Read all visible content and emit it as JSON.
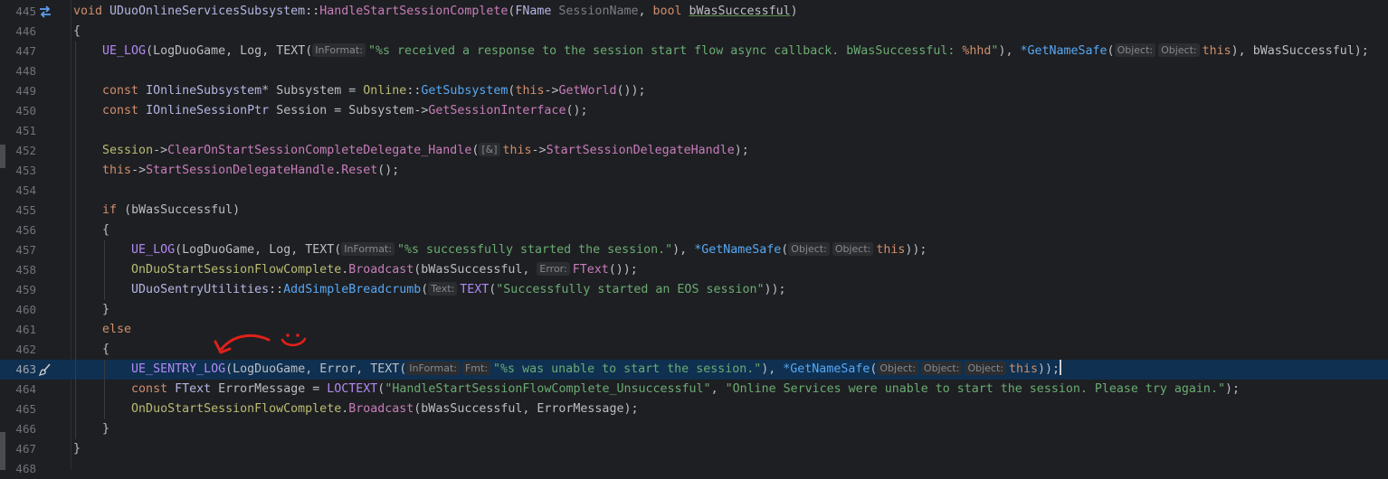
{
  "editor": {
    "lines": [
      {
        "n": "445",
        "segs": [
          [
            "kw",
            "void "
          ],
          [
            "ty",
            "UDuoOnlineServicesSubsystem"
          ],
          [
            "par",
            "::"
          ],
          [
            "fnp",
            "HandleStartSessionComplete"
          ],
          [
            "par",
            "("
          ],
          [
            "ty",
            "FName "
          ],
          [
            "grey",
            "SessionName"
          ],
          [
            "par",
            ", "
          ],
          [
            "kw",
            "bool "
          ],
          [
            "par underline",
            "bWasSuccessful"
          ],
          [
            "par",
            ")"
          ]
        ]
      },
      {
        "n": "446",
        "segs": [
          [
            "par",
            "{"
          ]
        ]
      },
      {
        "n": "447",
        "segs": [
          [
            "par",
            "    "
          ],
          [
            "mac2",
            "UE_LOG"
          ],
          [
            "par",
            "("
          ],
          [
            "par",
            "LogDuoGame"
          ],
          [
            "par",
            ", "
          ],
          [
            "par",
            "Log"
          ],
          [
            "par",
            ", "
          ],
          [
            "par",
            "TEXT("
          ],
          [
            "hint",
            "InFormat:"
          ],
          [
            "str",
            "\"%s received a response to the session start flow async callback. bWasSuccessful: "
          ],
          [
            "esc",
            "%hhd"
          ],
          [
            "str",
            "\""
          ],
          [
            "par",
            "), "
          ],
          [
            "fn",
            "*GetNameSafe"
          ],
          [
            "par",
            "("
          ],
          [
            "hint",
            "Object:"
          ],
          [
            "hint",
            "Object:"
          ],
          [
            "this",
            "this"
          ],
          [
            "par",
            "), "
          ],
          [
            "par",
            "bWasSuccessful"
          ],
          [
            "par",
            ");"
          ]
        ]
      },
      {
        "n": "448",
        "segs": []
      },
      {
        "n": "449",
        "segs": [
          [
            "par",
            "    "
          ],
          [
            "kw",
            "const "
          ],
          [
            "ty",
            "IOnlineSubsystem"
          ],
          [
            "par",
            "* "
          ],
          [
            "par",
            "Subsystem"
          ],
          [
            "par",
            " = "
          ],
          [
            "tya",
            "Online"
          ],
          [
            "par",
            "::"
          ],
          [
            "fn",
            "GetSubsystem"
          ],
          [
            "par",
            "("
          ],
          [
            "this",
            "this"
          ],
          [
            "par",
            "->"
          ],
          [
            "fnp",
            "GetWorld"
          ],
          [
            "par",
            "());"
          ]
        ]
      },
      {
        "n": "450",
        "segs": [
          [
            "par",
            "    "
          ],
          [
            "kw",
            "const "
          ],
          [
            "ty",
            "IOnlineSessionPtr "
          ],
          [
            "par",
            "Session"
          ],
          [
            "par",
            " = "
          ],
          [
            "par",
            "Subsystem"
          ],
          [
            "par",
            "->"
          ],
          [
            "fnp",
            "GetSessionInterface"
          ],
          [
            "par",
            "();"
          ]
        ]
      },
      {
        "n": "451",
        "segs": []
      },
      {
        "n": "452",
        "segs": [
          [
            "par",
            "    "
          ],
          [
            "tya",
            "Session"
          ],
          [
            "par",
            "->"
          ],
          [
            "fnp",
            "ClearOnStartSessionCompleteDelegate_Handle"
          ],
          [
            "par",
            "("
          ],
          [
            "hint",
            "[&]"
          ],
          [
            "this",
            "this"
          ],
          [
            "par",
            "->"
          ],
          [
            "fnp",
            "StartSessionDelegateHandle"
          ],
          [
            "par",
            ");"
          ]
        ]
      },
      {
        "n": "453",
        "segs": [
          [
            "par",
            "    "
          ],
          [
            "this",
            "this"
          ],
          [
            "par",
            "->"
          ],
          [
            "fnp",
            "StartSessionDelegateHandle"
          ],
          [
            "par",
            "."
          ],
          [
            "fnp",
            "Reset"
          ],
          [
            "par",
            "();"
          ]
        ]
      },
      {
        "n": "454",
        "segs": []
      },
      {
        "n": "455",
        "segs": [
          [
            "par",
            "    "
          ],
          [
            "kw",
            "if "
          ],
          [
            "par",
            "(bWasSuccessful)"
          ]
        ]
      },
      {
        "n": "456",
        "segs": [
          [
            "par",
            "    {"
          ]
        ]
      },
      {
        "n": "457",
        "segs": [
          [
            "par",
            "        "
          ],
          [
            "mac2",
            "UE_LOG"
          ],
          [
            "par",
            "("
          ],
          [
            "par",
            "LogDuoGame"
          ],
          [
            "par",
            ", "
          ],
          [
            "par",
            "Log"
          ],
          [
            "par",
            ", "
          ],
          [
            "par",
            "TEXT("
          ],
          [
            "hint",
            "InFormat:"
          ],
          [
            "str",
            "\"%s successfully started the session.\""
          ],
          [
            "par",
            "), "
          ],
          [
            "fn",
            "*GetNameSafe"
          ],
          [
            "par",
            "("
          ],
          [
            "hint",
            "Object:"
          ],
          [
            "hint",
            "Object:"
          ],
          [
            "this",
            "this"
          ],
          [
            "par",
            "));"
          ]
        ]
      },
      {
        "n": "458",
        "segs": [
          [
            "par",
            "        "
          ],
          [
            "tya",
            "OnDuoStartSessionFlowComplete"
          ],
          [
            "par",
            "."
          ],
          [
            "fnp",
            "Broadcast"
          ],
          [
            "par",
            "(bWasSuccessful, "
          ],
          [
            "hint",
            "Error:"
          ],
          [
            "fnp",
            "FText"
          ],
          [
            "par",
            "());"
          ]
        ]
      },
      {
        "n": "459",
        "segs": [
          [
            "par",
            "        "
          ],
          [
            "ty",
            "UDuoSentryUtilities"
          ],
          [
            "par",
            "::"
          ],
          [
            "fn",
            "AddSimpleBreadcrumb"
          ],
          [
            "par",
            "("
          ],
          [
            "hint",
            "Text:"
          ],
          [
            "mac2",
            "TEXT"
          ],
          [
            "par",
            "("
          ],
          [
            "str",
            "\"Successfully started an EOS session\""
          ],
          [
            "par",
            "));"
          ]
        ]
      },
      {
        "n": "460",
        "segs": [
          [
            "par",
            "    }"
          ]
        ]
      },
      {
        "n": "461",
        "segs": [
          [
            "par",
            "    "
          ],
          [
            "kw",
            "else"
          ]
        ]
      },
      {
        "n": "462",
        "segs": [
          [
            "par",
            "    {"
          ]
        ]
      },
      {
        "n": "463",
        "segs": [
          [
            "par",
            "        "
          ],
          [
            "mac2",
            "UE_SENTRY_LOG"
          ],
          [
            "par",
            "("
          ],
          [
            "par",
            "LogDuoGame"
          ],
          [
            "par",
            ", "
          ],
          [
            "par",
            "Error"
          ],
          [
            "par",
            ", "
          ],
          [
            "par",
            "TEXT("
          ],
          [
            "hint",
            "InFormat:"
          ],
          [
            "hint",
            "Fmt:"
          ],
          [
            "str",
            "\"%s was unable to start the session.\""
          ],
          [
            "par",
            "), "
          ],
          [
            "fn",
            "*GetNameSafe"
          ],
          [
            "par",
            "("
          ],
          [
            "hint",
            "Object:"
          ],
          [
            "hint",
            "Object:"
          ],
          [
            "hint",
            "Object:"
          ],
          [
            "this",
            "this"
          ],
          [
            "par",
            "));"
          ]
        ]
      },
      {
        "n": "464",
        "segs": [
          [
            "par",
            "        "
          ],
          [
            "kw",
            "const "
          ],
          [
            "ty",
            "FText "
          ],
          [
            "par",
            "ErrorMessage"
          ],
          [
            "par",
            " = "
          ],
          [
            "mac2",
            "LOCTEXT"
          ],
          [
            "par",
            "("
          ],
          [
            "str",
            "\"HandleStartSessionFlowComplete_Unsuccessful\""
          ],
          [
            "par",
            ", "
          ],
          [
            "str",
            "\"Online Services were unable to start the session. Please try again.\""
          ],
          [
            "par",
            ");"
          ]
        ]
      },
      {
        "n": "465",
        "segs": [
          [
            "par",
            "        "
          ],
          [
            "tya",
            "OnDuoStartSessionFlowComplete"
          ],
          [
            "par",
            "."
          ],
          [
            "fnp",
            "Broadcast"
          ],
          [
            "par",
            "(bWasSuccessful, ErrorMessage);"
          ]
        ]
      },
      {
        "n": "466",
        "segs": [
          [
            "par",
            "    }"
          ]
        ]
      },
      {
        "n": "467",
        "segs": [
          [
            "par",
            "}"
          ]
        ]
      },
      {
        "n": "468",
        "segs": []
      }
    ],
    "current_line": "463",
    "colors": {
      "background": "#1e1f22",
      "current_line": "#0f3050",
      "annotation": "#e0201b"
    },
    "gutter_icons": {
      "445": "override-arrows-icon",
      "463": "brush-icon"
    }
  }
}
